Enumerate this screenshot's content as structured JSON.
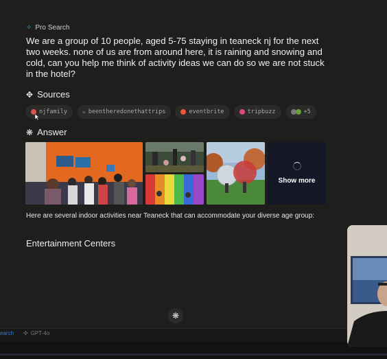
{
  "header": {
    "mode_label": "Pro Search"
  },
  "question": "We are a group of 10 people, aged 5-75 staying in teaneck nj for the next two weeks. none of us are from around here, it is raining and snowing and cold, can you help me think of activity ideas we can do so we are not stuck in the hotel?",
  "sources": {
    "heading": "Sources",
    "items": [
      {
        "label": "njfamily",
        "color": "#d9534f"
      },
      {
        "label": "beentheredonethattrips",
        "color": "#666666"
      },
      {
        "label": "eventbrite",
        "color": "#f05537"
      },
      {
        "label": "tripbuzz",
        "color": "#e0457b"
      },
      {
        "label": "+5",
        "color": "#6a9f3c"
      }
    ]
  },
  "answer": {
    "heading": "Answer",
    "show_more": "Show more",
    "text": "Here are several indoor activities near Teaneck that can accommodate your diverse age group:",
    "subheading": "Entertainment Centers"
  },
  "bottom_bar": {
    "search_label": "earch",
    "model_label": "GPT-4o"
  },
  "colors": {
    "background": "#1e1e1d",
    "accent": "#29a8b8",
    "link": "#2f7fd0"
  }
}
